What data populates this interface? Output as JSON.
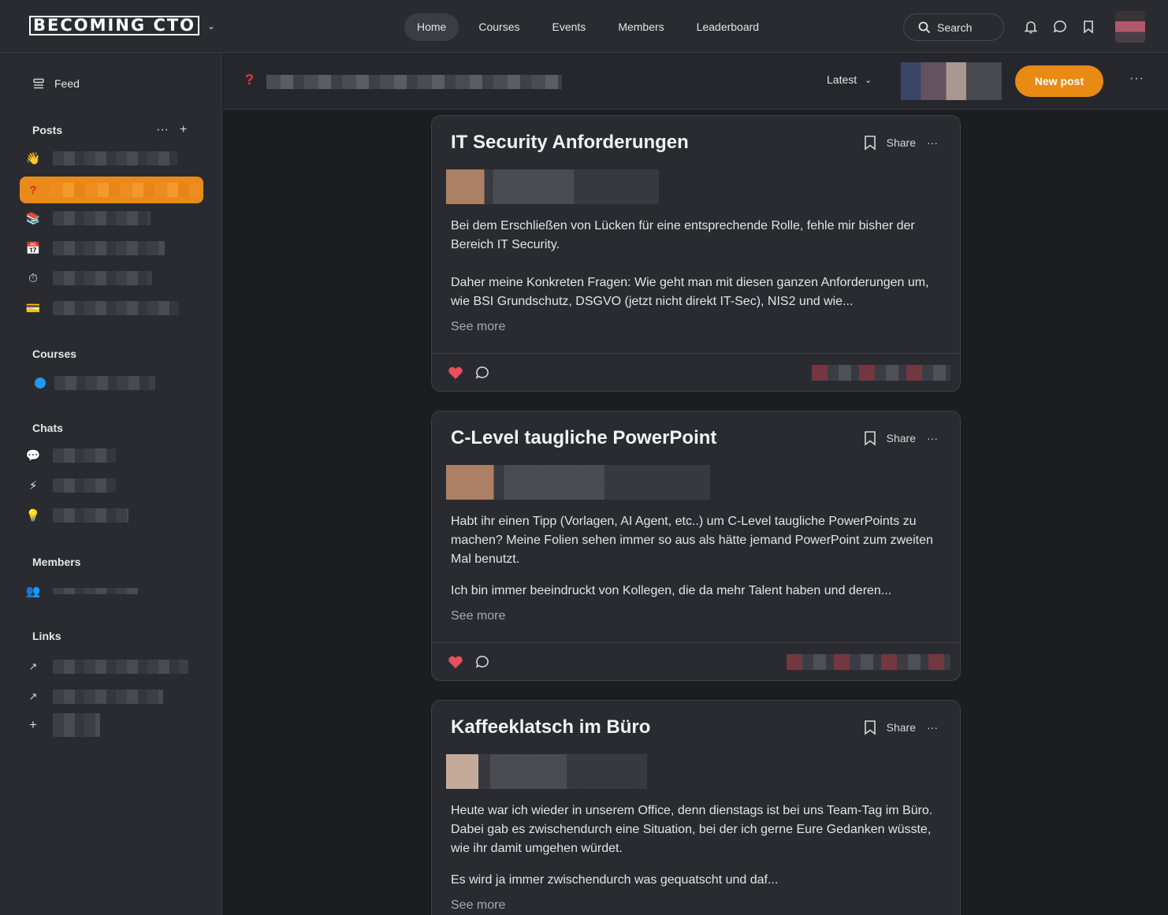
{
  "app": {
    "logo_text": "BECOMING CTO"
  },
  "nav": {
    "items": [
      "Home",
      "Courses",
      "Events",
      "Members",
      "Leaderboard"
    ],
    "active": "Home"
  },
  "search": {
    "label": "Search"
  },
  "sidebar": {
    "feed_label": "Feed",
    "posts_title": "Posts",
    "courses_title": "Courses",
    "chats_title": "Chats",
    "members_title": "Members",
    "links_title": "Links"
  },
  "subheader": {
    "sort_label": "Latest",
    "new_post_label": "New post"
  },
  "posts": [
    {
      "title": "IT Security Anforderungen",
      "share_label": "Share",
      "paragraphs": [
        "Bei dem Erschließen von Lücken für eine entsprechende Rolle, fehle mir bisher der Bereich IT Security.",
        "Daher meine Konkreten Fragen: Wie geht man mit diesen ganzen Anforderungen um, wie BSI Grundschutz, DSGVO (jetzt nicht direkt IT-Sec), NIS2 und wie..."
      ],
      "see_more": "See more"
    },
    {
      "title": "C-Level taugliche PowerPoint",
      "share_label": "Share",
      "paragraphs": [
        "Habt ihr einen Tipp (Vorlagen, AI Agent, etc..) um C-Level taugliche PowerPoints zu machen? Meine Folien sehen immer so aus als hätte jemand PowerPoint zum zweiten Mal benutzt.",
        "Ich bin immer beeindruckt von Kollegen, die da mehr Talent haben und deren..."
      ],
      "see_more": "See more"
    },
    {
      "title": "Kaffeeklatsch im Büro",
      "share_label": "Share",
      "paragraphs": [
        "Heute war ich wieder in unserem Office, denn dienstags ist bei uns Team-Tag im Büro. Dabei gab es zwischendurch eine Situation, bei der ich gerne Eure Gedanken wüsste, wie ihr damit umgehen würdet.",
        "Es wird ja immer zwischendurch was gequatscht und daf..."
      ],
      "see_more": "See more"
    }
  ],
  "colors": {
    "accent": "#e98a12",
    "heart": "#e8505b",
    "link_blue": "#2196f3"
  }
}
